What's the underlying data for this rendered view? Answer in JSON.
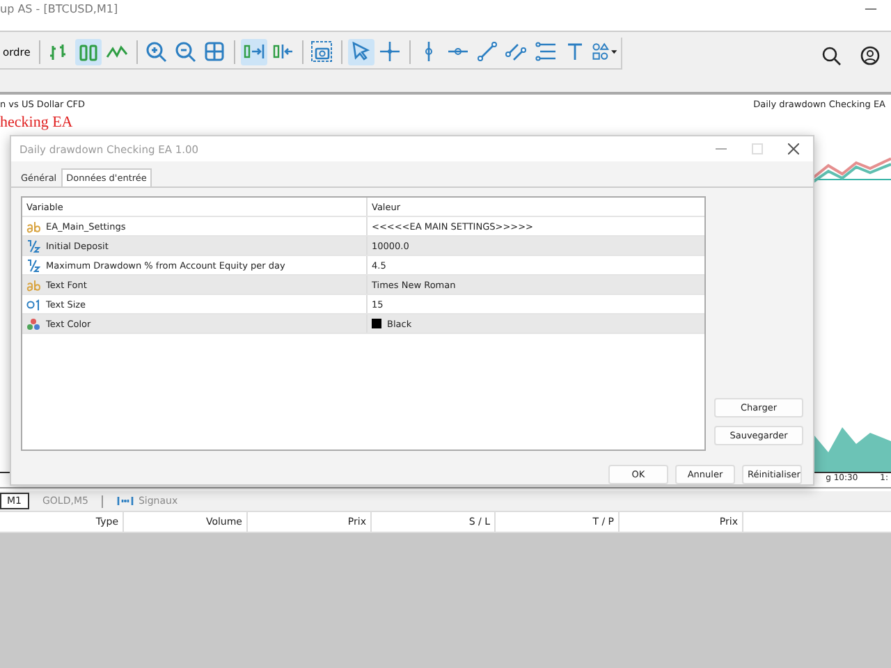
{
  "window": {
    "title": "up AS - [BTCUSD,M1]",
    "minimize": "—"
  },
  "toolbar": {
    "order_button": "ordre",
    "tools": [
      {
        "kind": "bars",
        "selected": false
      },
      {
        "kind": "candles",
        "selected": true
      },
      {
        "kind": "line",
        "selected": false
      },
      {
        "kind": "sep"
      },
      {
        "kind": "zoomin",
        "selected": false
      },
      {
        "kind": "zoomout",
        "selected": false
      },
      {
        "kind": "grid",
        "selected": false
      },
      {
        "kind": "sep"
      },
      {
        "kind": "autoscroll",
        "selected": true
      },
      {
        "kind": "shift",
        "selected": false
      },
      {
        "kind": "sep"
      },
      {
        "kind": "camera",
        "selected": false
      },
      {
        "kind": "sep"
      },
      {
        "kind": "cursor",
        "selected": true
      },
      {
        "kind": "cross",
        "selected": false
      },
      {
        "kind": "sep"
      },
      {
        "kind": "vline",
        "selected": false
      },
      {
        "kind": "hline",
        "selected": false
      },
      {
        "kind": "trend",
        "selected": false
      },
      {
        "kind": "channel",
        "selected": false
      },
      {
        "kind": "fibo",
        "selected": false
      },
      {
        "kind": "text",
        "selected": false
      },
      {
        "kind": "shapes",
        "selected": false
      }
    ]
  },
  "chart": {
    "symbol_label": "n vs US Dollar CFD",
    "ea_label": "Daily drawdown Checking EA",
    "overlay_text": "hecking EA",
    "time_labels": [
      "g 10:30",
      "1:"
    ]
  },
  "dialog": {
    "title": "Daily drawdown Checking EA 1.00",
    "tabs": [
      {
        "label": "Général",
        "selected": false
      },
      {
        "label": "Données d'entrée",
        "selected": true
      }
    ],
    "columns": [
      "Variable",
      "Valeur"
    ],
    "rows": [
      {
        "kind": "string",
        "name": "EA_Main_Settings",
        "value": "<<<<<EA MAIN SETTINGS>>>>>"
      },
      {
        "kind": "double",
        "name": "Initial Deposit",
        "value": "10000.0"
      },
      {
        "kind": "double",
        "name": "Maximum Drawdown % from Account Equity per day",
        "value": "4.5"
      },
      {
        "kind": "string",
        "name": "Text Font",
        "value": "Times New Roman"
      },
      {
        "kind": "int",
        "name": "Text Size",
        "value": "15"
      },
      {
        "kind": "color",
        "name": "Text Color",
        "value": "Black",
        "color": "#000000"
      }
    ],
    "side_buttons": [
      "Charger",
      "Sauvegarder"
    ],
    "buttons": [
      "OK",
      "Annuler",
      "Réinitialiser"
    ]
  },
  "chart_tabs": [
    {
      "label": "M1",
      "selected": true,
      "kind": "chart"
    },
    {
      "label": "GOLD,M5",
      "selected": false,
      "kind": "chart"
    },
    {
      "label": "Signaux",
      "selected": false,
      "kind": "signals"
    }
  ],
  "trade_columns": [
    "Type",
    "Volume",
    "Prix",
    "S / L",
    "T / P",
    "Prix"
  ]
}
